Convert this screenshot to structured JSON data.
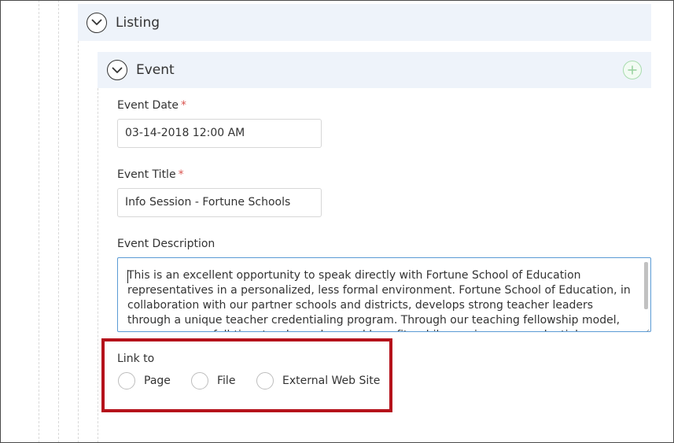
{
  "sections": {
    "listing": {
      "title": "Listing",
      "icon": "chevron-down-icon"
    },
    "event": {
      "title": "Event",
      "icon": "chevron-down-icon",
      "add_icon": "plus-icon"
    }
  },
  "form": {
    "event_date": {
      "label": "Event Date",
      "required_mark": "*",
      "value": "03-14-2018 12:00 AM"
    },
    "event_title": {
      "label": "Event Title",
      "required_mark": "*",
      "value": "Info Session - Fortune Schools"
    },
    "event_description": {
      "label": "Event Description",
      "value": "This is an excellent opportunity to speak directly with Fortune School of Education representatives in a personalized, less formal environment. Fortune School of Education, in collaboration with our partner schools and districts, develops strong teacher leaders through a unique teacher credentialing program. Through our teaching fellowship model, you can earn a full-time teacher salary and benefits while earning your credential."
    },
    "link_to": {
      "label": "Link to",
      "options": [
        "Page",
        "File",
        "External Web Site"
      ],
      "selected": null
    }
  },
  "colors": {
    "panel_bg": "#eef3fa",
    "highlight_border": "#b5121b",
    "required": "#d9534f",
    "add_icon": "#a8dcae",
    "focus_border": "#5b9bd5"
  }
}
